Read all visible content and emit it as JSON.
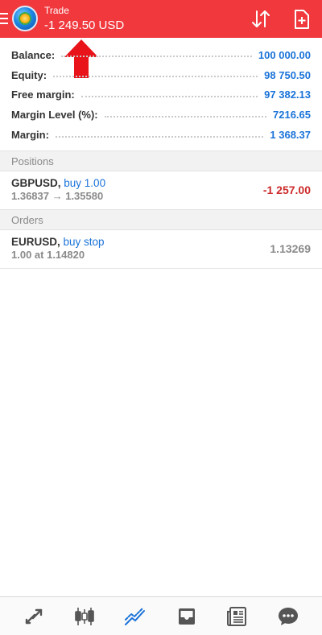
{
  "header": {
    "title": "Trade",
    "profit": "-1 249.50 USD",
    "menu_icon": "menu-icon",
    "logo_icon": "app-logo",
    "sort_icon": "sort-arrows-icon",
    "new_order_icon": "new-document-icon",
    "accent_color": "#f0383d"
  },
  "summary": {
    "rows": [
      {
        "label": "Balance:",
        "value": "100 000.00"
      },
      {
        "label": "Equity:",
        "value": "98 750.50"
      },
      {
        "label": "Free margin:",
        "value": "97 382.13"
      },
      {
        "label": "Margin Level (%):",
        "value": "7216.65"
      },
      {
        "label": "Margin:",
        "value": "1 368.37"
      }
    ],
    "value_color": "#1a73d9"
  },
  "positions": {
    "header": "Positions",
    "items": [
      {
        "symbol": "GBPUSD,",
        "type": "buy 1.00",
        "prices": "1.36837 → 1.35580",
        "profit": "-1 257.00"
      }
    ]
  },
  "orders": {
    "header": "Orders",
    "items": [
      {
        "symbol": "EURUSD,",
        "type": "buy stop",
        "details": "1.00 at 1.14820",
        "price": "1.13269"
      }
    ]
  },
  "bottom_nav": {
    "items": [
      {
        "icon": "quotes-arrows-icon"
      },
      {
        "icon": "candlestick-chart-icon"
      },
      {
        "icon": "trade-chart-icon",
        "active": true
      },
      {
        "icon": "history-inbox-icon"
      },
      {
        "icon": "news-icon"
      },
      {
        "icon": "chat-bubble-icon"
      }
    ],
    "active_color": "#1a73d9",
    "inactive_color": "#555555"
  }
}
